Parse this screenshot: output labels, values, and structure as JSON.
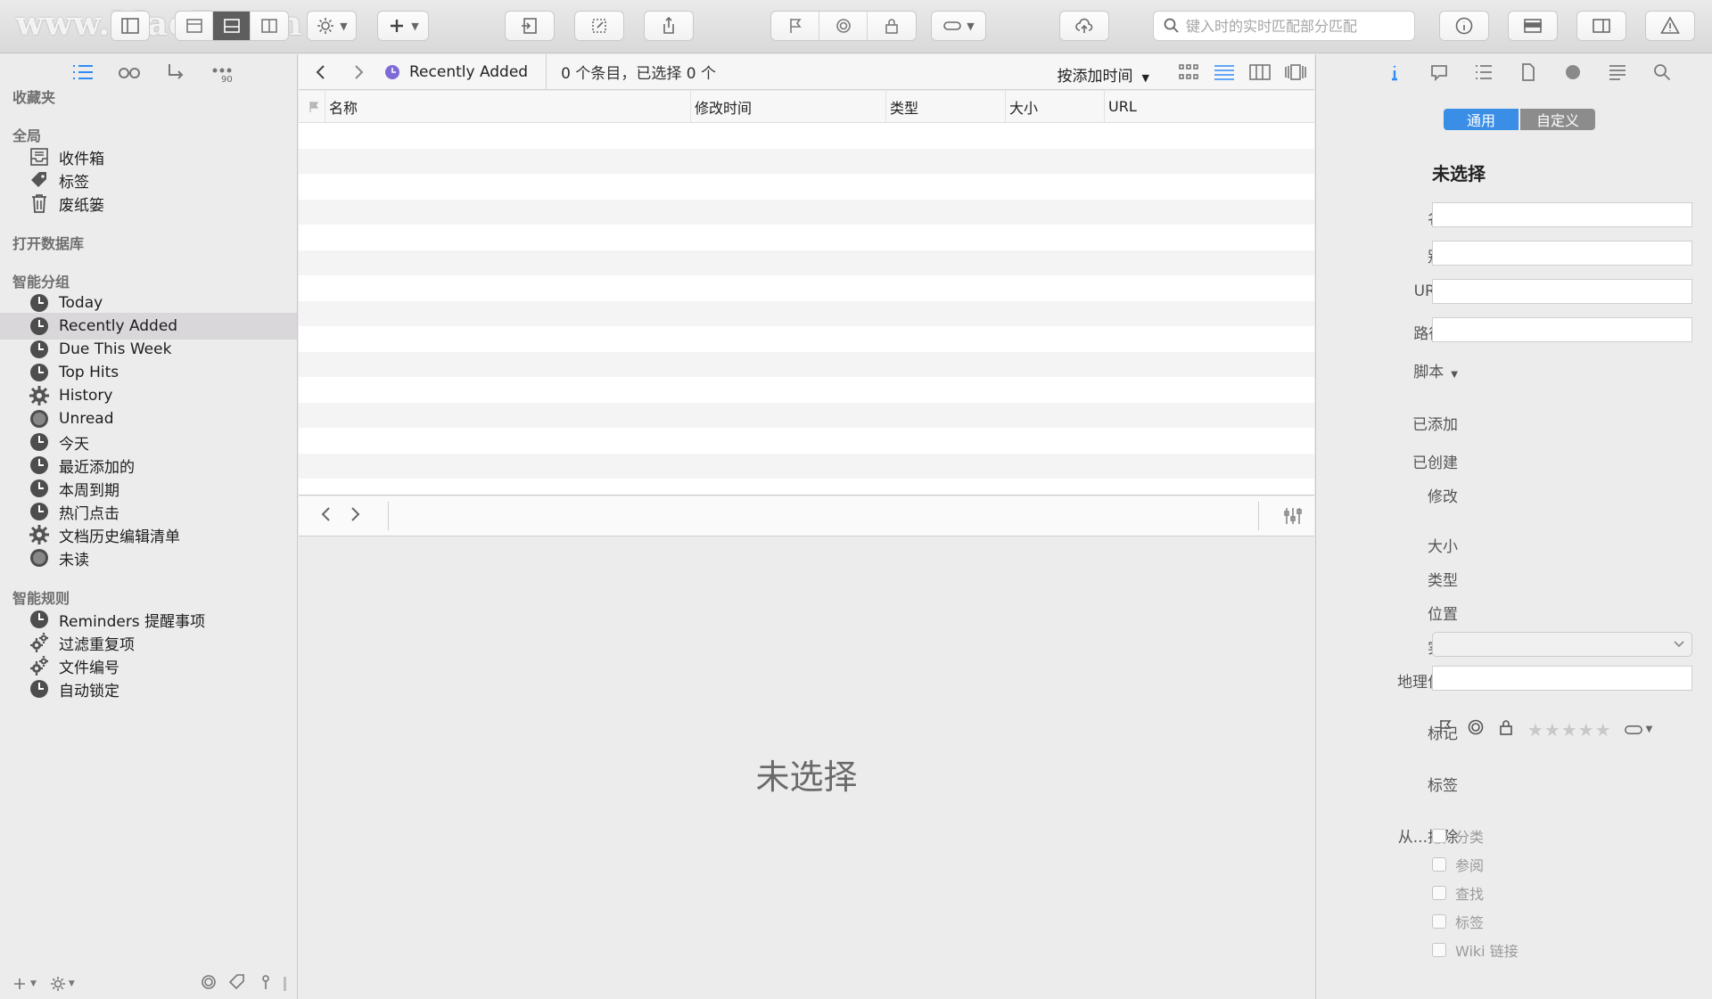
{
  "watermark": "www.MacZ.com",
  "toolbar": {
    "search_placeholder": "键入时的实时匹配部分匹配"
  },
  "sidebar": {
    "sections": {
      "favorites": "收藏夹",
      "global": "全局",
      "open_db": "打开数据库",
      "smart_groups": "智能分组",
      "smart_rules": "智能规则"
    },
    "global_items": [
      {
        "label": "收件箱",
        "icon": "inbox-icon"
      },
      {
        "label": "标签",
        "icon": "tag-icon"
      },
      {
        "label": "废纸篓",
        "icon": "trash-icon"
      }
    ],
    "smart_group_items": [
      {
        "label": "Today",
        "icon": "clock-icon"
      },
      {
        "label": "Recently Added",
        "icon": "clock-icon",
        "selected": true
      },
      {
        "label": "Due This Week",
        "icon": "clock-icon"
      },
      {
        "label": "Top Hits",
        "icon": "clock-icon"
      },
      {
        "label": "History",
        "icon": "gear-icon"
      },
      {
        "label": "Unread",
        "icon": "circle-icon"
      },
      {
        "label": "今天",
        "icon": "clock-icon"
      },
      {
        "label": "最近添加的",
        "icon": "clock-icon"
      },
      {
        "label": "本周到期",
        "icon": "clock-icon"
      },
      {
        "label": "热门点击",
        "icon": "clock-icon"
      },
      {
        "label": "文档历史编辑清单",
        "icon": "gear-icon"
      },
      {
        "label": "未读",
        "icon": "circle-icon"
      }
    ],
    "smart_rule_items": [
      {
        "label": "Reminders 提醒事项",
        "icon": "clock-icon"
      },
      {
        "label": "过滤重复项",
        "icon": "gears-icon"
      },
      {
        "label": "文件编号",
        "icon": "gears-icon"
      },
      {
        "label": "自动锁定",
        "icon": "clock-icon"
      }
    ],
    "tab_badge": "90"
  },
  "center": {
    "crumb": "Recently Added",
    "count_text": "0 个条目，已选择 0 个",
    "sort_label": "按添加时间",
    "columns": [
      "名称",
      "修改时间",
      "类型",
      "大小",
      "URL"
    ],
    "empty_text": "未选择"
  },
  "inspector": {
    "seg_general": "通用",
    "seg_custom": "自定义",
    "title": "未选择",
    "labels": {
      "name": "名称",
      "alias": "别名",
      "url": "URL",
      "path": "路径",
      "script": "脚本",
      "added": "已添加",
      "created": "已创建",
      "modified": "修改",
      "size": "大小",
      "kind": "类型",
      "location": "位置",
      "instances": "实例",
      "geo": "地理位置",
      "marks": "标记",
      "tags": "标签",
      "exclude": "从...排除"
    },
    "rating_stars": "★★★★★",
    "exclude_options": [
      "分类",
      "参阅",
      "查找",
      "标签",
      "Wiki 链接"
    ]
  },
  "colors": {
    "accent": "#2f8bf5",
    "selection": "#d9d7d9",
    "sidebar_bg": "#ececec"
  }
}
